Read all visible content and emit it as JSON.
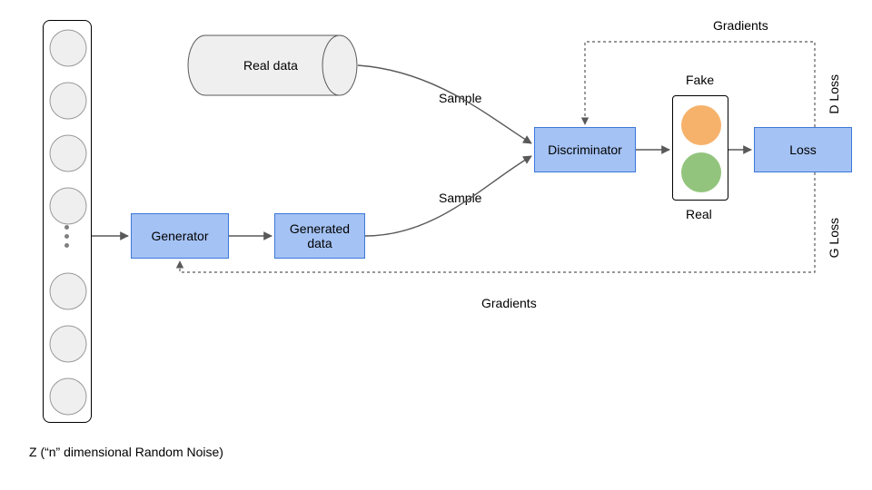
{
  "nodes": {
    "generator": "Generator",
    "generated_data": "Generated\ndata",
    "discriminator": "Discriminator",
    "loss": "Loss",
    "real_data": "Real data"
  },
  "labels": {
    "sample_top": "Sample",
    "sample_bottom": "Sample",
    "fake": "Fake",
    "real": "Real",
    "gradients_top": "Gradients",
    "gradients_bottom": "Gradients",
    "d_loss": "D Loss",
    "g_loss": "G Loss",
    "z_caption": "Z (“n” dimensional Random Noise)"
  },
  "colors": {
    "node_fill": "#a4c2f4",
    "node_stroke": "#3c78d8",
    "noise_fill": "#efefef",
    "noise_stroke": "#999999",
    "cyl_fill": "#efefef",
    "cyl_stroke": "#595959",
    "fake_fill": "#f6b26b",
    "real_fill": "#93c47d",
    "line": "#595959"
  }
}
